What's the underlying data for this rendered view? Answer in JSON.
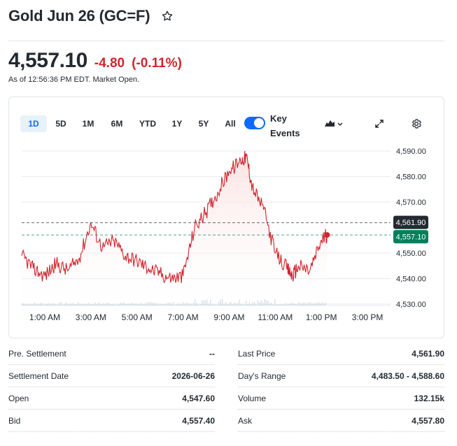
{
  "header": {
    "title": "Gold Jun 26 (GC=F)",
    "price": "4,557.10",
    "change": "-4.80",
    "change_pct": "(-0.11%)",
    "as_of": "As of 12:56:36 PM EDT. Market Open.",
    "colors": {
      "negative": "#d1252e",
      "accent": "#0f69ff"
    }
  },
  "chart_controls": {
    "ranges": [
      "1D",
      "5D",
      "1M",
      "6M",
      "YTD",
      "1Y",
      "5Y",
      "All"
    ],
    "active_range": "1D",
    "key_events_label": "Key Events",
    "key_events_on": true,
    "icons": [
      "mountain-chart-icon",
      "chevron-down-icon",
      "expand-icon",
      "gear-icon",
      "star-icon"
    ]
  },
  "chart_data": {
    "type": "area",
    "x_tick_labels": [
      "1:00 AM",
      "3:00 AM",
      "5:00 AM",
      "7:00 AM",
      "9:00 AM",
      "11:00 AM",
      "1:00 PM",
      "3:00 PM"
    ],
    "y_tick_labels": [
      "4,590.00",
      "4,580.00",
      "4,570.00",
      "4,561.90",
      "4,557.10",
      "4,550.00",
      "4,540.00",
      "4,530.00"
    ],
    "ylim": [
      4530,
      4590
    ],
    "reference_lines": [
      {
        "label": "4,561.90",
        "value": 4561.9,
        "color": "#232a31"
      },
      {
        "label": "4,557.10",
        "value": 4557.1,
        "color": "#00805a"
      }
    ],
    "line_color": "#d1252e",
    "fill_color": "#fbdede",
    "series": [
      {
        "x": [
          0.0,
          0.5,
          1.0,
          1.5,
          2.0,
          2.5,
          3.0,
          3.5,
          4.0,
          4.5,
          5.0,
          5.5,
          6.0,
          6.5,
          7.0,
          7.5,
          8.0,
          8.5,
          9.0,
          9.5,
          9.75,
          10.0,
          10.5,
          11.0,
          11.5,
          11.75,
          12.0,
          12.5,
          13.0,
          13.25
        ],
        "y": [
          4549,
          4544,
          4541,
          4546,
          4543,
          4548,
          4562,
          4552,
          4555,
          4549,
          4547,
          4544,
          4542,
          4540,
          4541,
          4560,
          4566,
          4574,
          4582,
          4586,
          4588,
          4576,
          4567,
          4550,
          4544,
          4541,
          4545,
          4543,
          4555,
          4557.1
        ]
      }
    ],
    "volume_shown": true
  },
  "stats": {
    "left": [
      {
        "label": "Pre. Settlement",
        "value": "--"
      },
      {
        "label": "Settlement Date",
        "value": "2026-06-26"
      },
      {
        "label": "Open",
        "value": "4,547.60"
      },
      {
        "label": "Bid",
        "value": "4,557.40"
      }
    ],
    "right": [
      {
        "label": "Last Price",
        "value": "4,561.90"
      },
      {
        "label": "Day's Range",
        "value": "4,483.50 - 4,588.60"
      },
      {
        "label": "Volume",
        "value": "132.15k"
      },
      {
        "label": "Ask",
        "value": "4,557.80"
      }
    ]
  }
}
